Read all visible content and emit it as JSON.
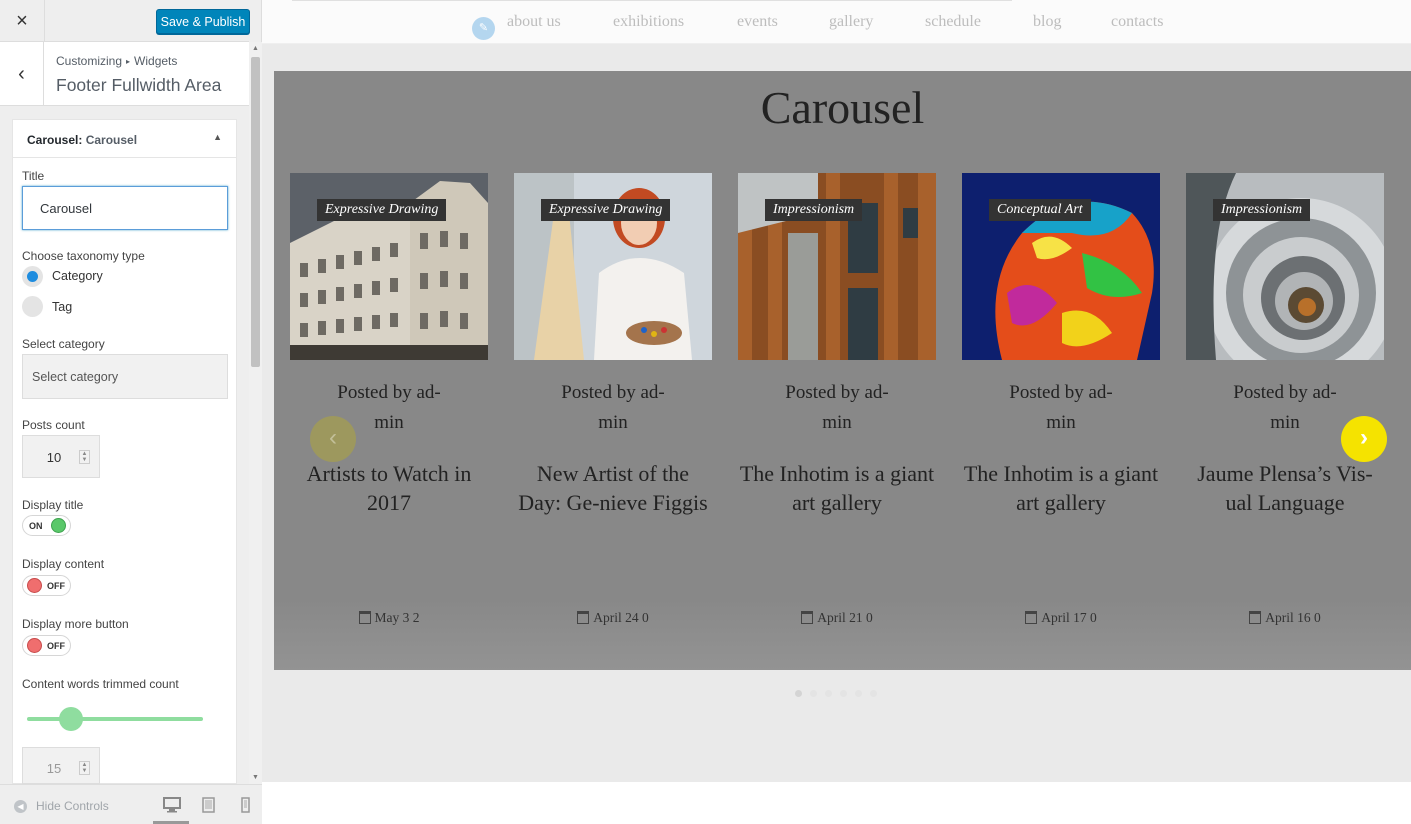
{
  "sidebar": {
    "close_icon": "×",
    "save_label": "Save & Publish",
    "back_icon": "‹",
    "breadcrumb": {
      "root": "Customizing",
      "sep": "▸",
      "current": "Widgets"
    },
    "section_title": "Footer Fullwidth Area",
    "widget": {
      "title_prefix": "Carousel:",
      "title_name": "Carousel",
      "toggle_icon": "▲"
    },
    "fields": {
      "title_label": "Title",
      "title_value": "Carousel",
      "taxonomy_label": "Choose taxonomy type",
      "taxonomy_options": [
        {
          "label": "Category",
          "selected": true
        },
        {
          "label": "Tag",
          "selected": false
        }
      ],
      "category_label": "Select category",
      "category_placeholder": "Select category",
      "posts_count_label": "Posts count",
      "posts_count_value": "10",
      "display_title_label": "Display title",
      "display_title_state": "ON",
      "display_content_label": "Display content",
      "display_content_state": "OFF",
      "display_more_label": "Display more button",
      "display_more_state": "OFF",
      "trim_label": "Content words trimmed count",
      "trim_value": "15",
      "trim_slider_fraction": 0.25
    },
    "bottom": {
      "hide_controls_label": "Hide Controls",
      "devices": [
        "desktop-icon",
        "tablet-icon",
        "mobile-icon"
      ],
      "active_device": "desktop"
    }
  },
  "preview": {
    "nav": [
      "about us",
      "exhibitions",
      "events",
      "gallery",
      "schedule",
      "blog",
      "contacts"
    ],
    "carousel_title": "Carousel",
    "cards": [
      {
        "tag": "Expressive Drawing",
        "posted": "Posted by ad-\nmin",
        "title": "Artists to Watch in 2017",
        "date": "May 3 2",
        "image": "building"
      },
      {
        "tag": "Expressive Drawing",
        "posted": "Posted by ad-\nmin",
        "title": "New Artist of the Day: Ge-nieve Figgis",
        "date": "April 24 0",
        "image": "painter"
      },
      {
        "tag": "Impressionism",
        "posted": "Posted by ad-\nmin",
        "title": "The Inhotim is a giant art gallery",
        "date": "April 21 0",
        "image": "wood-facade"
      },
      {
        "tag": "Conceptual Art",
        "posted": "Posted by ad-\nmin",
        "title": "The Inhotim is a giant art gallery",
        "date": "April 17 0",
        "image": "color-face"
      },
      {
        "tag": "Impressionism",
        "posted": "Posted by ad-\nmin",
        "title": "Jaume Plensa’s Vis-ual Language",
        "date": "April 16 0",
        "image": "spiral-stair"
      }
    ],
    "prev_icon": "‹",
    "next_icon": "›",
    "dot_count": 6,
    "active_dot": 0,
    "colors": {
      "accent_yellow": "#f5e300",
      "publish_blue": "#0085ba",
      "toggle_on": "#5ac86a",
      "toggle_off": "#ef6e6e"
    }
  }
}
